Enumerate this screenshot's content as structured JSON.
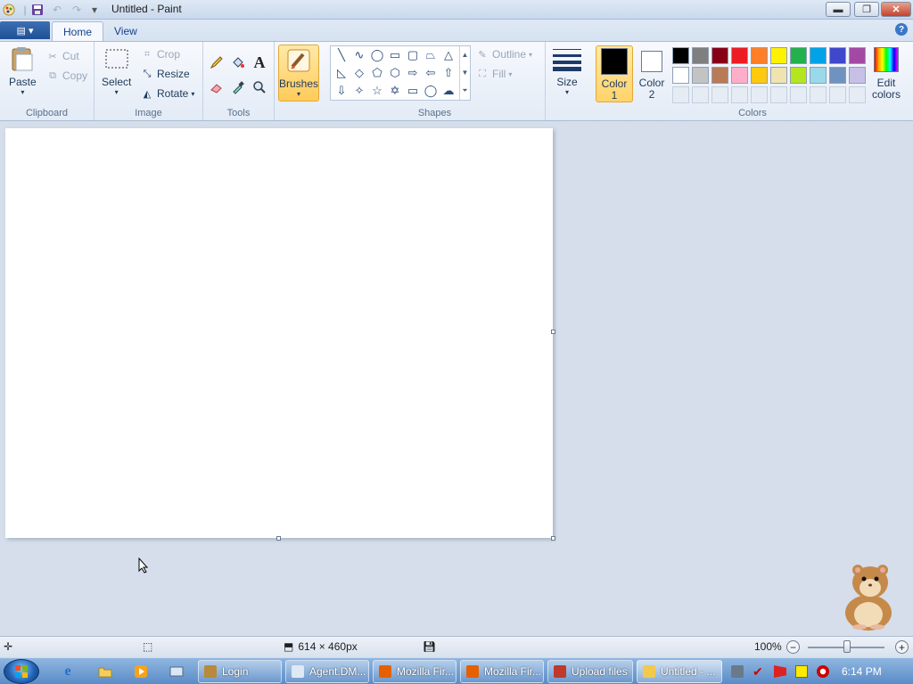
{
  "window": {
    "title": "Untitled - Paint"
  },
  "tabs": [
    {
      "label": "Home"
    },
    {
      "label": "View"
    }
  ],
  "ribbon": {
    "clipboard": {
      "paste": "Paste",
      "cut": "Cut",
      "copy": "Copy",
      "label": "Clipboard"
    },
    "image": {
      "select": "Select",
      "crop": "Crop",
      "resize": "Resize",
      "rotate": "Rotate",
      "label": "Image"
    },
    "tools": {
      "label": "Tools",
      "text_glyph": "A"
    },
    "brushes": {
      "label": "Brushes"
    },
    "shapes": {
      "label": "Shapes",
      "outline": "Outline",
      "fill": "Fill"
    },
    "size": {
      "label": "Size"
    },
    "colors": {
      "label": "Colors",
      "color1": "Color 1",
      "color1_line1": "Color",
      "color1_line2": "1",
      "color2_line1": "Color",
      "color2_line2": "2",
      "edit_line1": "Edit",
      "edit_line2": "colors",
      "color1_value": "#000000",
      "color2_value": "#ffffff",
      "palette_row1": [
        "#000000",
        "#7f7f7f",
        "#880015",
        "#ed1c24",
        "#ff7f27",
        "#fff200",
        "#22b14c",
        "#00a2e8",
        "#3f48cc",
        "#a349a4"
      ],
      "palette_row2": [
        "#ffffff",
        "#c3c3c3",
        "#b97a57",
        "#ffaec9",
        "#ffc90e",
        "#efe4b0",
        "#b5e61d",
        "#99d9ea",
        "#7092be",
        "#c8bfe7"
      ]
    }
  },
  "status": {
    "dimensions": "614 × 460px",
    "zoom": "100%"
  },
  "taskbar": {
    "items": [
      {
        "label": "Login",
        "color": "#b88a3a"
      },
      {
        "label": "Agent.DM...",
        "color": "#dfe8f5"
      },
      {
        "label": "Mozilla Fir...",
        "color": "#e66000"
      },
      {
        "label": "Mozilla Fir...",
        "color": "#e66000"
      },
      {
        "label": "Upload files",
        "color": "#c0392b"
      },
      {
        "label": "Untitled - ...",
        "color": "#f2c94c"
      }
    ],
    "clock": "6:14 PM"
  }
}
